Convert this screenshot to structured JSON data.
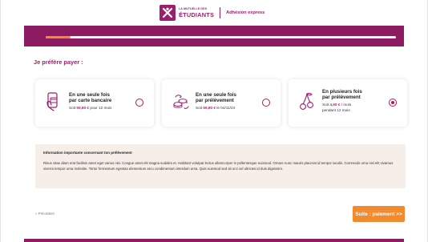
{
  "header": {
    "logo_small": "LA MUTUELLE DES",
    "logo_big": "ÉTUDIANTS",
    "title": "Adhésion express"
  },
  "progress": {
    "value": 0.07
  },
  "main": {
    "section_title": "Je préfère payer :",
    "options": [
      {
        "title_line1": "En une seule fois",
        "title_line2": "par carte bancaire",
        "sub_prefix": "Soit ",
        "price": "59,80 €",
        "sub_suffix": " pour 12 mois",
        "sub_line2": "",
        "selected": false,
        "icon": "card-payment-icon"
      },
      {
        "title_line1": "En une seule fois",
        "title_line2": "par prélèvement",
        "sub_prefix": "Soit ",
        "price": "59,80 €",
        "sub_suffix": " le 04/11/24",
        "sub_line2": "",
        "selected": false,
        "icon": "coins-icon"
      },
      {
        "title_line1": "En plusieurs fois",
        "title_line2": "par prélèvement",
        "sub_prefix": "Soit ",
        "price": "4,90 €",
        "sub_suffix": " / mois",
        "sub_line2": "pendant 12 mois",
        "selected": true,
        "icon": "cherries-icon"
      }
    ],
    "info": {
      "title": "Information importante concernant ton prélèvement",
      "body": "Risus vitae diam erat facilisis amet eget varius nisi. Congue amet elit magna sodales et. Habitant volutpat lectus ullamcorper in pellentesque euismod. Ornare nunc mauris placerat id tempor iaculis. Commodo urna nisl elit vivamus viverra tempor urna molestie. Tortor fermentum egestas elementum arcu condimentum interdum urna. Quis euismod sed sit orci vel ultricies id duis dignissim."
    }
  },
  "footer": {
    "prev_label": "« Précédent",
    "next_label": "Suite : paiement  >>"
  },
  "colors": {
    "brand": "#9b1f6d",
    "accent": "#f28a2e",
    "price": "#c2187a",
    "info_bg": "#f6eee8"
  }
}
